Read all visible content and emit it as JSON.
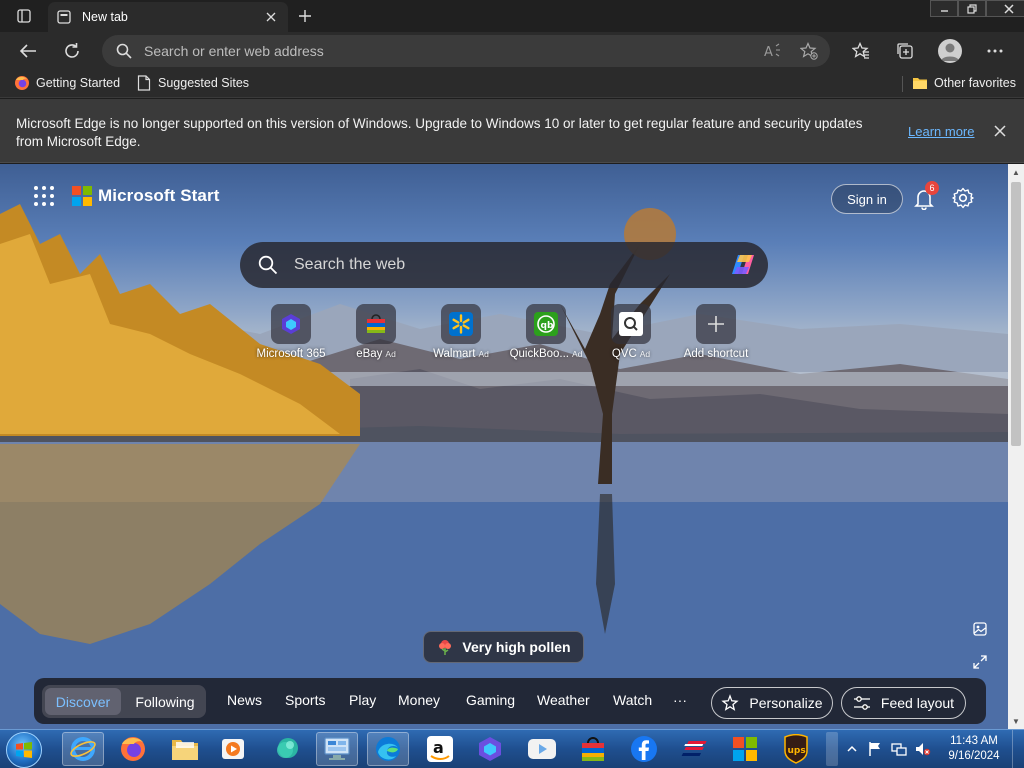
{
  "tab": {
    "title": "New tab"
  },
  "address": {
    "placeholder": "Search or enter web address"
  },
  "favorites": {
    "items": [
      "Getting Started",
      "Suggested Sites"
    ],
    "other": "Other favorites"
  },
  "infobar": {
    "message": "Microsoft Edge is no longer supported on this version of Windows. Upgrade to Windows 10 or later to get regular feature and security updates from Microsoft Edge.",
    "link": "Learn more"
  },
  "start_page": {
    "brand": "Microsoft Start",
    "sign_in": "Sign in",
    "notification_count": "6",
    "search_placeholder": "Search the web",
    "shortcuts": [
      {
        "label": "Microsoft 365",
        "ad": ""
      },
      {
        "label": "eBay",
        "ad": "Ad"
      },
      {
        "label": "Walmart",
        "ad": "Ad"
      },
      {
        "label": "QuickBoo...",
        "ad": "Ad"
      },
      {
        "label": "QVC",
        "ad": "Ad"
      },
      {
        "label": "Add shortcut",
        "ad": ""
      }
    ],
    "pollen": "Very high pollen",
    "feed": {
      "tabs": [
        "Discover",
        "Following"
      ],
      "nav": [
        "News",
        "Sports",
        "Play",
        "Money",
        "Gaming",
        "Weather",
        "Watch",
        "···"
      ],
      "personalize": "Personalize",
      "layout": "Feed layout"
    }
  },
  "taskbar": {
    "time": "11:43 AM",
    "date": "9/16/2024"
  },
  "colors": {
    "accent_link": "#6cb8ff",
    "badge": "#e8453c",
    "taskbar": "#1f4f8f"
  }
}
